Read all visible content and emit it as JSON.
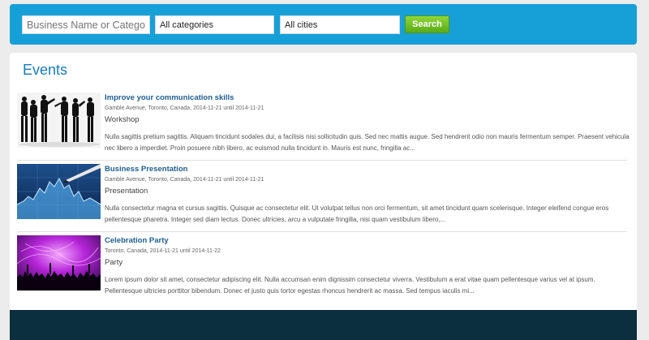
{
  "search": {
    "keyword_placeholder": "Business Name or Category",
    "category_value": "All categories",
    "city_value": "All cities",
    "button_label": "Search"
  },
  "events_section": {
    "title": "Events",
    "items": [
      {
        "title": "Improve your communication skills",
        "meta": "Gamble Avenue, Toronto, Canada, 2014-11-21 until 2014-11-21",
        "type": "Workshop",
        "description": "Nulla sagittis pretium sagittis. Aliquam tincidunt sodales dui, a facilisis nisi sollicitudin quis. Sed nec mattis augue. Sed hendrerit odio non mauris fermentum semper. Praesent vehicula nec libero a imperdiet. Proin posuere nibh libero, ac euismod nulla tincidunt in. Mauris est nunc, fringilla ac...",
        "image": "business-people-silhouettes"
      },
      {
        "title": "Business Presentation",
        "meta": "Gamble Avenue, Toronto, Canada, 2014-11-21 until 2014-11-21",
        "type": "Presentation",
        "description": "Nulla consectetur magna et cursus sagittis. Quisque ac consectetur elit. Ut volutpat tellus non orci fermentum, sit amet tincidunt quam scelerisque. Integer eleifend congue eros pellentesque pharetra. Integer sed diam lectus. Donec ultricies, arcu a vulputate fringilla, nisi quam vestibulum libero,...",
        "image": "stock-chart-with-pen"
      },
      {
        "title": "Celebration Party",
        "meta": "Toronto, Canada, 2014-11-21 until 2014-11-22",
        "type": "Party",
        "description": "Lorem ipsum dolor sit amet, consectetur adipiscing elit. Nulla accumsan enim dignissim consectetur viverra. Vestibulum a erat vitae quam pellentesque varius vel at ipsum. Pellentesque ultricies porttitor bibendum. Donec et justo quis tortor egestas rhoncus hendrerit ac massa. Sed tempus iaculis mi...",
        "image": "party-crowd-purple-lights"
      }
    ]
  },
  "colors": {
    "header_bg": "#17a0d8",
    "button_green": "#6cbf22",
    "title_blue": "#1a7bb9",
    "footer_bg": "#0c2f3d"
  }
}
